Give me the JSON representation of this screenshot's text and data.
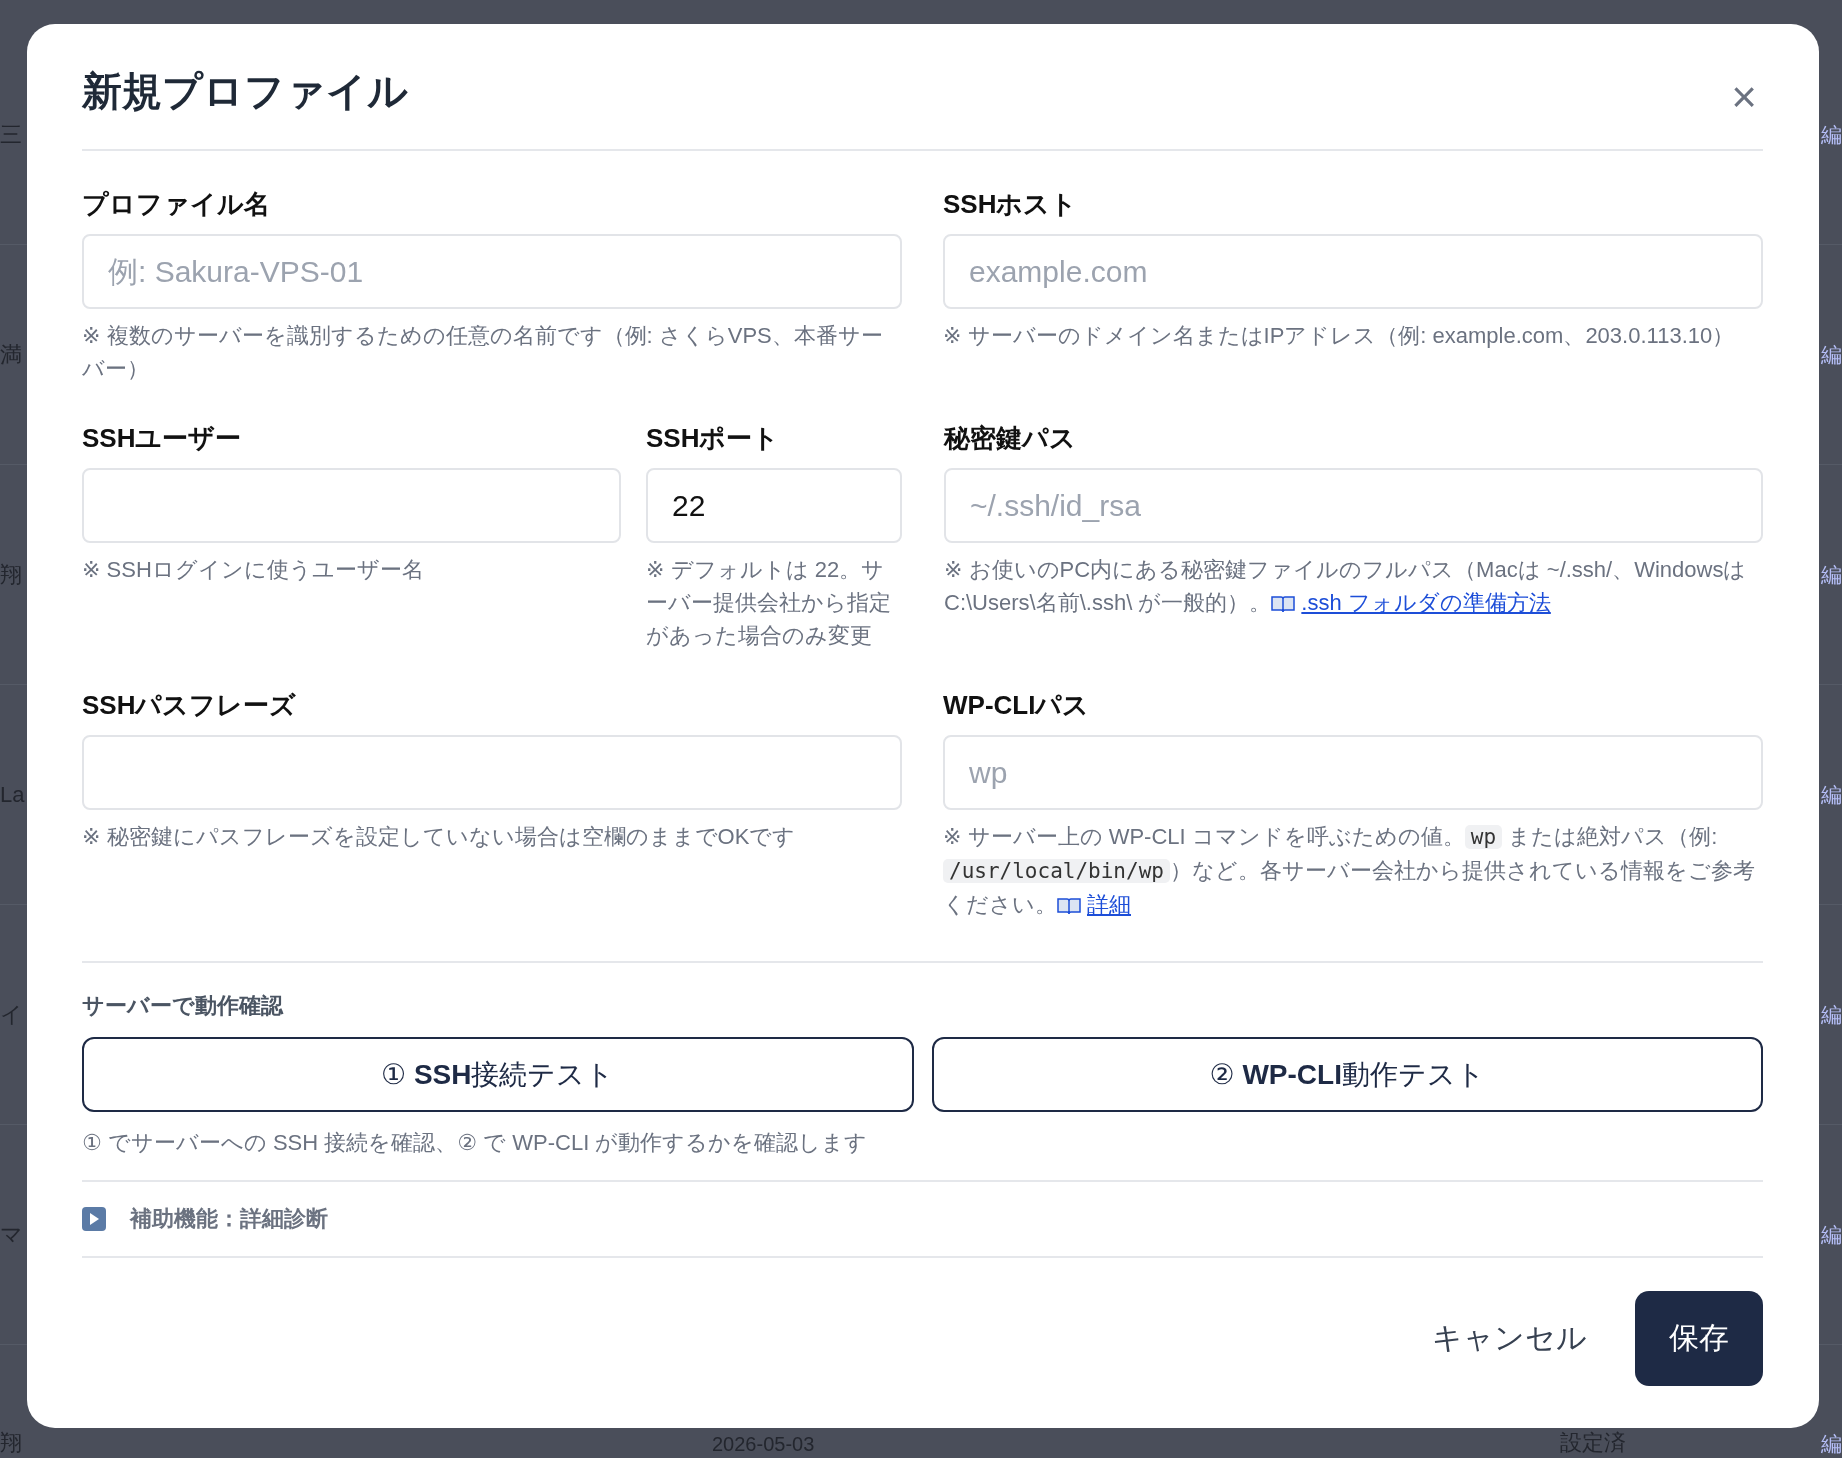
{
  "background": {
    "rows": [
      {
        "left": "三",
        "right": "編"
      },
      {
        "left": "満",
        "right": "編"
      },
      {
        "left": "翔",
        "right": "編"
      },
      {
        "left": "La",
        "right": "編"
      },
      {
        "left": "イ",
        "right": "編"
      },
      {
        "left": "マ",
        "right": "編"
      }
    ],
    "last_row": {
      "left": "翔",
      "date": "2026-05-03",
      "status": "設定済",
      "right": "編"
    }
  },
  "dialog": {
    "title": "新規プロファイル",
    "close": "×",
    "field_rows": [
      [
        {
          "label": "プロファイル名",
          "placeholder": "例: Sakura-VPS-01",
          "help": [
            {
              "kind": "text",
              "text": "※ 複数のサーバーを識別するための任意の名前です（例: さくらVPS、本番サーバー）"
            }
          ]
        },
        {
          "label": "SSHホスト",
          "placeholder": "example.com",
          "help": [
            {
              "kind": "text",
              "text": "※ サーバーのドメイン名またはIPアドレス（例: example.com、203.0.113.10）"
            }
          ]
        }
      ],
      [
        {
          "label": "SSHユーザー",
          "help": [
            {
              "kind": "text",
              "text": "※ SSHログインに使うユーザー名"
            }
          ]
        },
        {
          "label": "SSHポート",
          "value": "22",
          "help": [
            {
              "kind": "text",
              "text": "※ デフォルトは 22。サーバー提供会社から指定があった場合のみ変更"
            }
          ]
        },
        {
          "label": "秘密鍵パス",
          "placeholder": "~/.ssh/id_rsa",
          "help": [
            {
              "kind": "text",
              "text": "※ お使いのPC内にある秘密鍵ファイルのフルパス（Macは ~/.ssh/、Windowsは C:\\Users\\名前\\.ssh\\ が一般的）。"
            },
            {
              "kind": "link",
              "text": ".ssh フォルダの準備方法"
            }
          ]
        }
      ],
      [
        {
          "label": "SSHパスフレーズ",
          "help": [
            {
              "kind": "text",
              "text": "※ 秘密鍵にパスフレーズを設定していない場合は空欄のままでOKです"
            }
          ]
        },
        {
          "label": "WP-CLIパス",
          "placeholder": "wp",
          "help": [
            {
              "kind": "text",
              "text": "※ サーバー上の WP-CLI コマンドを呼ぶための値。"
            },
            {
              "kind": "code",
              "text": "wp"
            },
            {
              "kind": "text",
              "text": " または絶対パス（例: "
            },
            {
              "kind": "code",
              "text": "/usr/local/bin/wp"
            },
            {
              "kind": "text",
              "text": "）など。各サーバー会社から提供されている情報をご参考ください。"
            },
            {
              "kind": "link",
              "text": "詳細"
            }
          ]
        }
      ]
    ],
    "test_section": {
      "heading": "サーバーで動作確認",
      "buttons": [
        "① **SSH**接続テスト",
        "② **WP-CLI**動作テスト"
      ],
      "note": "① でサーバーへの SSH 接続を確認、② で WP-CLI が動作するかを確認します"
    },
    "details": {
      "label": "補助機能：詳細診断",
      "expanded": false
    },
    "footer": {
      "cancel": "キャンセル",
      "save": "保存"
    }
  }
}
